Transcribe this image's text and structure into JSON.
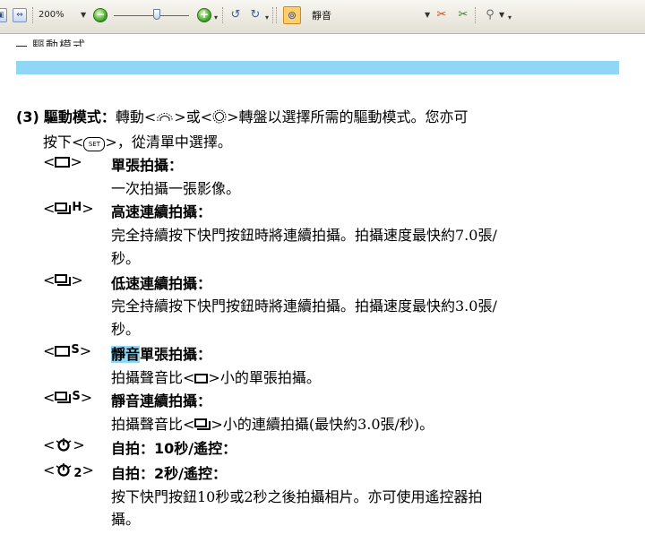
{
  "toolbar": {
    "zoom_value": "200%",
    "select_value": "靜音"
  },
  "document": {
    "cut_heading": "驅動模式",
    "item_number": "(3)",
    "item_title": "驅動模式：",
    "intro_line1_a": "轉動<",
    "intro_line1_b": ">或<",
    "intro_line1_c": ">轉盤以選擇所需的驅動模式。您亦可",
    "intro_line2_a": "按下<",
    "intro_line2_b": ">，從清單中選擇。",
    "set_label": "SET",
    "lt": "<",
    "gt": ">",
    "modes": [
      {
        "title": "單張拍攝：",
        "desc": [
          "一次拍攝一張影像。"
        ]
      },
      {
        "letter": "H",
        "title": "高速連續拍攝：",
        "desc": [
          "完全持續按下快門按鈕時將連續拍攝。拍攝速度最快約7.0張/",
          "秒。"
        ]
      },
      {
        "title": "低速連續拍攝：",
        "desc": [
          "完全持續按下快門按鈕時將連續拍攝。拍攝速度最快約3.0張/",
          "秒。"
        ]
      },
      {
        "letter": "S",
        "title_highlight": "靜音",
        "title_rest": "單張拍攝：",
        "desc_a": "拍攝聲音比<",
        "desc_b": ">小的單張拍攝。"
      },
      {
        "letter": "S",
        "title": "靜音連續拍攝：",
        "desc_a": "拍攝聲音比<",
        "desc_b": ">小的連續拍攝(最快約3.0張/秒)。"
      },
      {
        "title": "自拍：10秒/遙控："
      },
      {
        "sub": "2",
        "title": "自拍：2秒/遙控：",
        "desc": [
          "按下快門按鈕10秒或2秒之後拍攝相片。亦可使用遙控器拍",
          "攝。"
        ]
      }
    ]
  }
}
